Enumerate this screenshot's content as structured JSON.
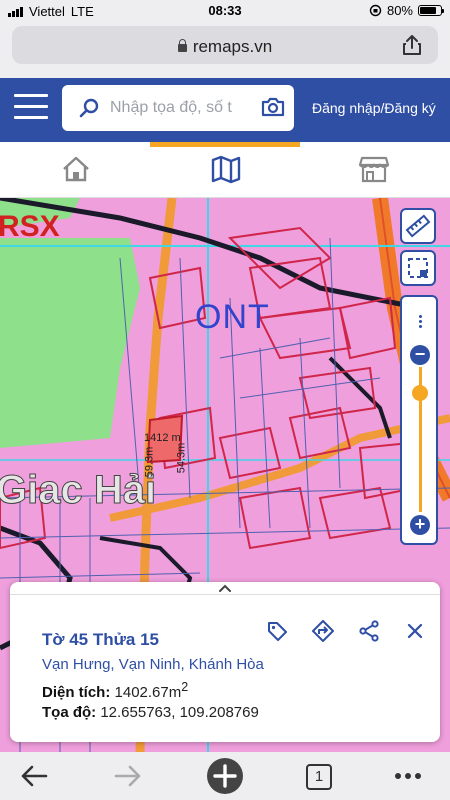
{
  "status_bar": {
    "carrier": "Viettel",
    "network": "LTE",
    "time": "08:33",
    "battery": "80%",
    "battery_level": 0.8
  },
  "browser": {
    "url": "remaps.vn"
  },
  "header": {
    "search_placeholder": "Nhập tọa độ, số t",
    "login_label": "Đăng nhập/Đăng ký",
    "accent_color": "#2f4fa5",
    "highlight_color": "#f5a623"
  },
  "tabs": [
    {
      "icon": "home-icon"
    },
    {
      "icon": "map-icon",
      "active": true
    },
    {
      "icon": "store-icon"
    }
  ],
  "map": {
    "labels": {
      "zone_ont": "ONT",
      "zone_rsx": "RSX",
      "place": "Giac Hải"
    },
    "dimensions": [
      "1412 m",
      "59.3m",
      "54.3m"
    ],
    "zoom_level_fraction": 0.18
  },
  "parcel": {
    "title": "Tờ 45 Thửa 15",
    "address": "Vạn Hưng, Vạn Ninh, Khánh Hòa",
    "area_label": "Diện tích:",
    "area_value": "1402.67m",
    "area_unit_sup": "2",
    "coord_label": "Tọa độ:",
    "coord_value": "12.655763, 109.208769"
  },
  "toolbar": {
    "tab_count": "1"
  }
}
